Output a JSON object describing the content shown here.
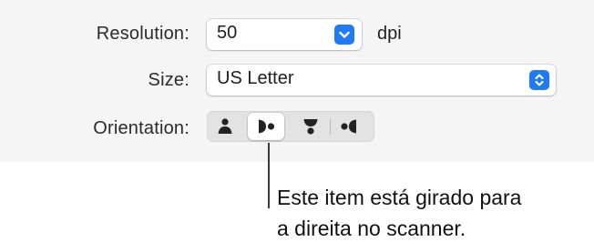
{
  "form": {
    "resolution": {
      "label": "Resolution:",
      "value": "50",
      "unit": "dpi"
    },
    "size": {
      "label": "Size:",
      "value": "US Letter"
    },
    "orientation": {
      "label": "Orientation:",
      "options": [
        "portrait-upright-icon",
        "rotated-right-icon",
        "upside-down-icon",
        "rotated-left-icon"
      ],
      "selected_index": 1
    }
  },
  "callout": {
    "line1": "Este item está girado para",
    "line2": "a direita no scanner."
  },
  "colors": {
    "accent": "#1f7bf5",
    "panel_bg": "#f5f5f5",
    "segment_bg": "#e3e3e3"
  }
}
